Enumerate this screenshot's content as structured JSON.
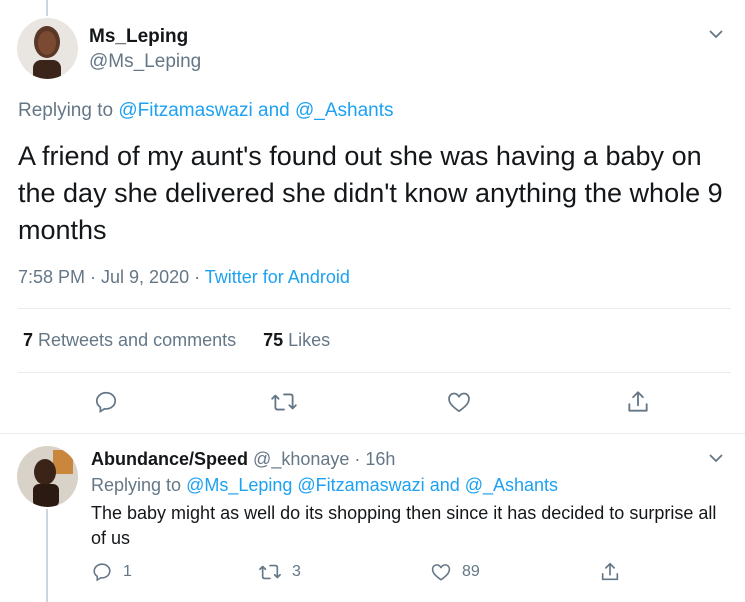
{
  "main_tweet": {
    "author": {
      "name": "Ms_Leping",
      "handle": "@Ms_Leping"
    },
    "replying_prefix": "Replying to ",
    "replying_mention_1": "@Fitzamaswazi",
    "replying_and": " and ",
    "replying_mention_2": "@_Ashants",
    "text": "A friend of my aunt's found out she was having a baby on the day she delivered she didn't know anything the whole 9 months",
    "time": "7:58 PM · Jul 9, 2020 · ",
    "source": "Twitter for Android",
    "retweets_count": "7",
    "retweets_label": " Retweets and comments",
    "likes_count": "75",
    "likes_label": " Likes"
  },
  "reply": {
    "author": {
      "name": "Abundance/Speed",
      "handle": "@_khonaye",
      "age": "· 16h"
    },
    "replying_prefix": "Replying to ",
    "replying_mentions": "@Ms_Leping @Fitzamaswazi",
    "replying_and": " and ",
    "replying_mention_last": "@_Ashants",
    "text": "The baby might as well do its shopping then since it has decided to surprise all of us",
    "reply_count": "1",
    "retweet_count": "3",
    "like_count": "89"
  },
  "icons": [
    "chevron-down-icon",
    "reply-icon",
    "retweet-icon",
    "like-icon",
    "share-icon"
  ],
  "colors": {
    "accent": "#1da1f2",
    "muted": "#657786",
    "text": "#14171a",
    "divider": "#e6ecf0"
  }
}
